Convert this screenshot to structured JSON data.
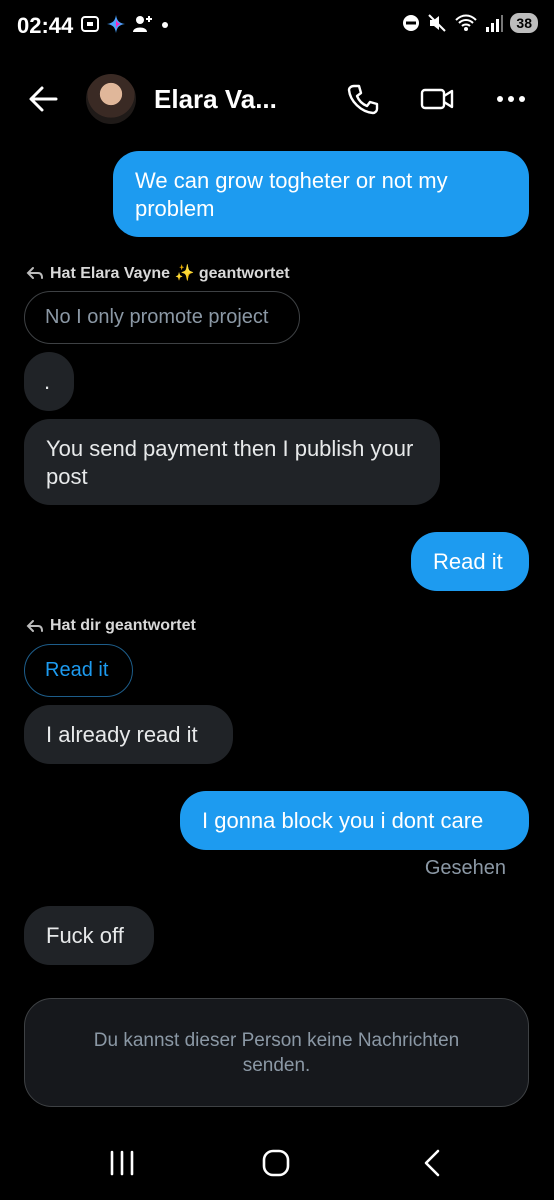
{
  "status_bar": {
    "time": "02:44",
    "battery": "38"
  },
  "header": {
    "name": "Elara Va..."
  },
  "messages": {
    "m1": "We can grow togheter or not my problem",
    "reply1_label": "Hat Elara Vayne ✨ geantwortet",
    "reply1_quote": "No I only promote project",
    "m2": ".",
    "m3": "You send payment then I publish your post",
    "m4": "Read it",
    "reply2_label": "Hat dir geantwortet",
    "reply2_quote": "Read it",
    "m5": "I already read it",
    "m6": "I gonna block you i dont care",
    "seen": "Gesehen",
    "m7": "Fuck off"
  },
  "composer": {
    "blocked_text": "Du kannst dieser Person keine Nachrichten senden."
  },
  "colors": {
    "accent": "#1d9bf0",
    "incoming": "#202327",
    "background": "#000000"
  }
}
